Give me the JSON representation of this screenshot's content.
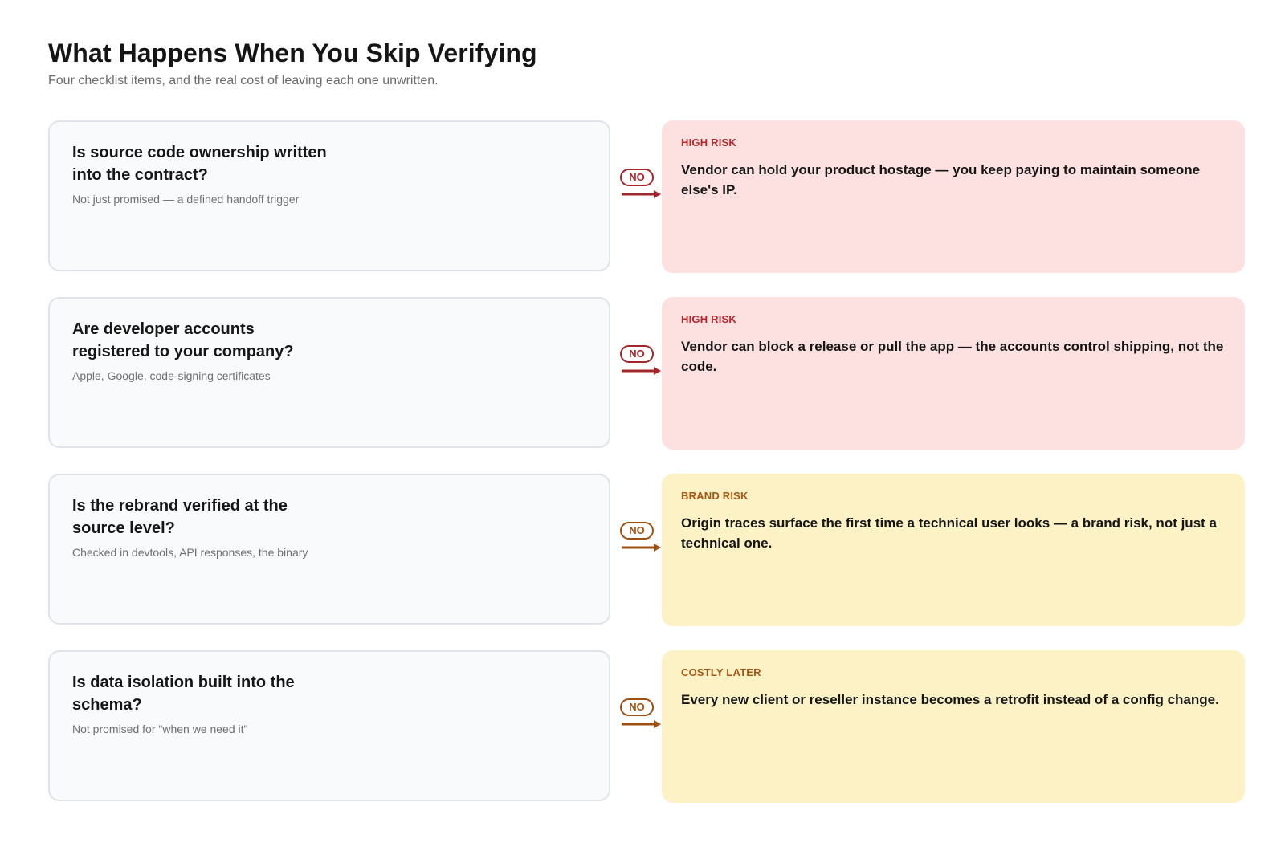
{
  "header": {
    "title": "What Happens When You Skip Verifying",
    "subtitle": "Four checklist items, and the real cost of leaving each one unwritten."
  },
  "colors": {
    "high_risk_card": "#fde1e1",
    "high_risk_accent": "#a3262a",
    "medium_risk_card": "#fdf2c6",
    "medium_risk_accent": "#9e4f12",
    "question_card": "#f9fafc",
    "question_border": "#e0e3ea"
  },
  "rows": [
    {
      "tone": "high",
      "question": "Is source code ownership written into the contract?",
      "note": "Not just promised — a defined handoff trigger",
      "badge": "NO",
      "risk_label": "HIGH RISK",
      "outcome": "Vendor can hold your product hostage — you keep paying to maintain someone else's IP."
    },
    {
      "tone": "high",
      "question": "Are developer accounts registered to your company?",
      "note": "Apple, Google, code-signing certificates",
      "badge": "NO",
      "risk_label": "HIGH RISK",
      "outcome": "Vendor can block a release or pull the app — the accounts control shipping, not the code."
    },
    {
      "tone": "med",
      "question": "Is the rebrand verified at the source level?",
      "note": "Checked in devtools, API responses, the binary",
      "badge": "NO",
      "risk_label": "BRAND RISK",
      "outcome": "Origin traces surface the first time a technical user looks — a brand risk, not just a technical one."
    },
    {
      "tone": "med",
      "question": "Is data isolation built into the schema?",
      "note": "Not promised for \"when we need it\"",
      "badge": "NO",
      "risk_label": "COSTLY LATER",
      "outcome": "Every new client or reseller instance becomes a retrofit instead of a config change."
    }
  ]
}
